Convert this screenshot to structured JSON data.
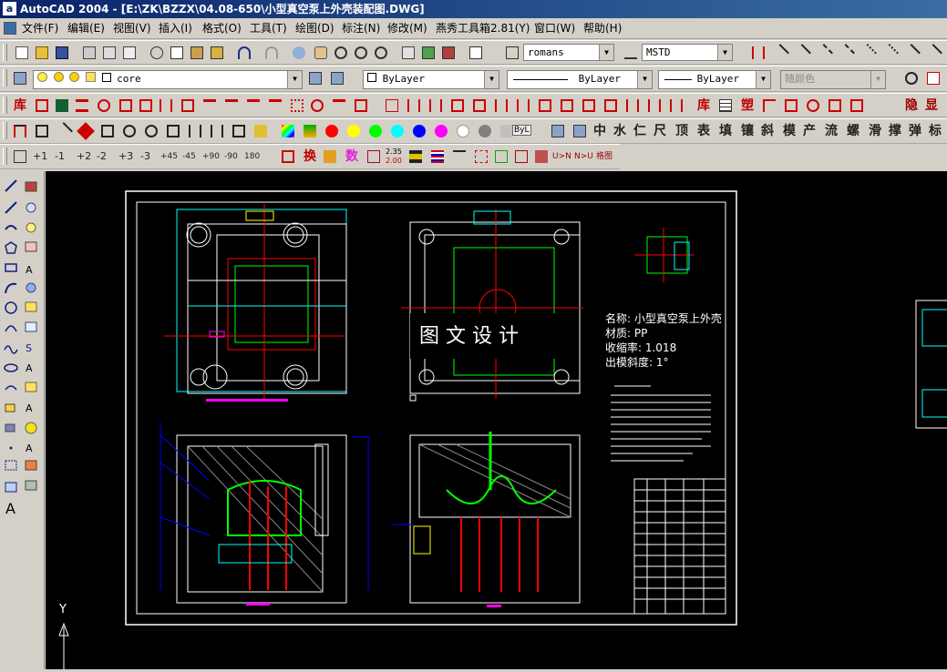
{
  "window": {
    "title": "AutoCAD 2004 - [E:\\ZK\\BZZX\\04.08-650\\小型真空泵上外壳装配图.DWG]",
    "app_icon_letter": "a"
  },
  "menu": [
    "文件(F)",
    "编辑(E)",
    "视图(V)",
    "插入(I)",
    "格式(O)",
    "工具(T)",
    "绘图(D)",
    "标注(N)",
    "修改(M)",
    "燕秀工具箱2.81(Y)",
    "窗口(W)",
    "帮助(H)"
  ],
  "toolbar1": {
    "text_style": "romans",
    "dim_style": "MSTD"
  },
  "toolbar2": {
    "layer": "core",
    "color": "ByLayer",
    "linetype": "ByLayer",
    "lineweight": "ByLayer",
    "plot_style": "随颜色"
  },
  "toolbar3": {
    "chars_left": "库",
    "chars_right": [
      "库",
      "塑",
      "隐",
      "显"
    ]
  },
  "toolbar4": {
    "chars": [
      "中",
      "水",
      "仁",
      "尺",
      "顶",
      "表",
      "填",
      "镶",
      "斜",
      "模",
      "产",
      "流",
      "螺",
      "滑",
      "撑",
      "弹",
      "标"
    ],
    "colors": [
      "#ff0000",
      "#ffff00",
      "#00ff00",
      "#00ffff",
      "#0000ff",
      "#ff00ff",
      "#ffffff",
      "#808080",
      "#c0c0c0"
    ],
    "bylayer_short": "ByL"
  },
  "toolbar5": {
    "nums": [
      "+1",
      "-1",
      "+2",
      "-2",
      "+3",
      "-3",
      "+45",
      "-45",
      "+90",
      "-90",
      "180"
    ],
    "chars": [
      "换",
      "数"
    ],
    "scale_top": "2.35",
    "scale_bottom": "2.00",
    "un": "U>N",
    "nu": "N>U",
    "last": "格图"
  },
  "drawing": {
    "watermark": "图 文 设 计",
    "part_name": "名称: 小型真空泵上外壳",
    "material": "材质: PP",
    "shrinkage": "收缩率: 1.018",
    "draft": "出模斜度: 1°",
    "ucs_label": "Y"
  }
}
